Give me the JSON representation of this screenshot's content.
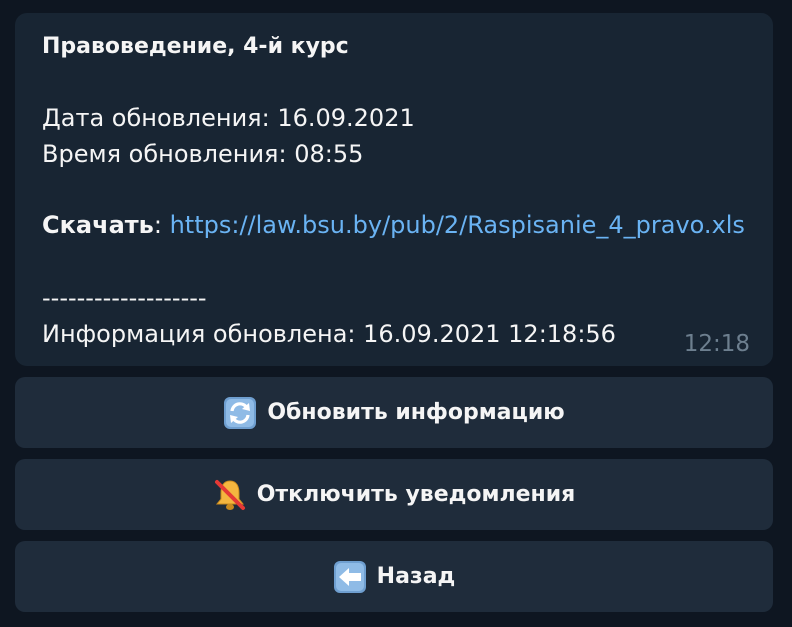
{
  "message": {
    "title": "Правоведение, 4-й курс",
    "date_line": "Дата обновления: 16.09.2021",
    "time_line": "Время обновления: 08:55",
    "download_label": "Скачать",
    "download_colon": ":",
    "download_url": "https://law.bsu.by/pub/2/Raspisanie_4_pravo.xls",
    "separator": "-------------------",
    "info_line": "Информация обновлена: 16.09.2021 12:18:56",
    "time": "12:18"
  },
  "buttons": {
    "refresh": {
      "label": "Обновить информацию",
      "icon": "refresh-arrows-icon"
    },
    "mute": {
      "label": "Отключить уведомления",
      "icon": "bell-off-icon"
    },
    "back": {
      "label": "Назад",
      "icon": "left-arrow-icon"
    }
  },
  "colors": {
    "background": "#0e1621",
    "bubble": "#182533",
    "button": "#1f2c3b",
    "link": "#6ab3f3",
    "timestamp": "#6d7f8f"
  }
}
